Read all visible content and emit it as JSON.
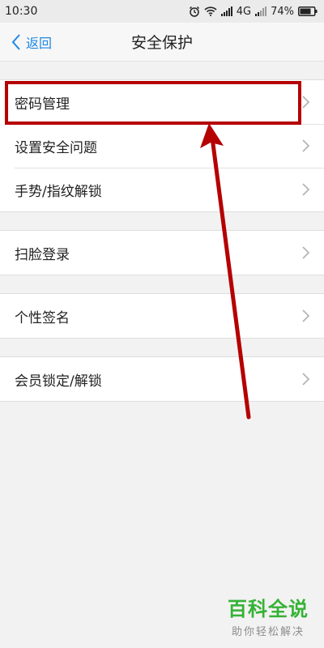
{
  "status": {
    "time": "10:30",
    "network": "4G",
    "battery": "74%"
  },
  "nav": {
    "back_label": "返回",
    "title": "安全保护"
  },
  "groups": [
    {
      "items": [
        {
          "label": "密码管理"
        },
        {
          "label": "设置安全问题"
        },
        {
          "label": "手势/指纹解锁"
        }
      ]
    },
    {
      "items": [
        {
          "label": "扫脸登录"
        }
      ]
    },
    {
      "items": [
        {
          "label": "个性签名"
        }
      ]
    },
    {
      "items": [
        {
          "label": "会员锁定/解锁"
        }
      ]
    }
  ],
  "annotation": {
    "color": "#b50000",
    "target": "密码管理"
  },
  "watermark": {
    "main": "百科全说",
    "sub": "助你轻松解决"
  },
  "colors": {
    "accent": "#1e88e5",
    "watermark": "#35b235"
  }
}
